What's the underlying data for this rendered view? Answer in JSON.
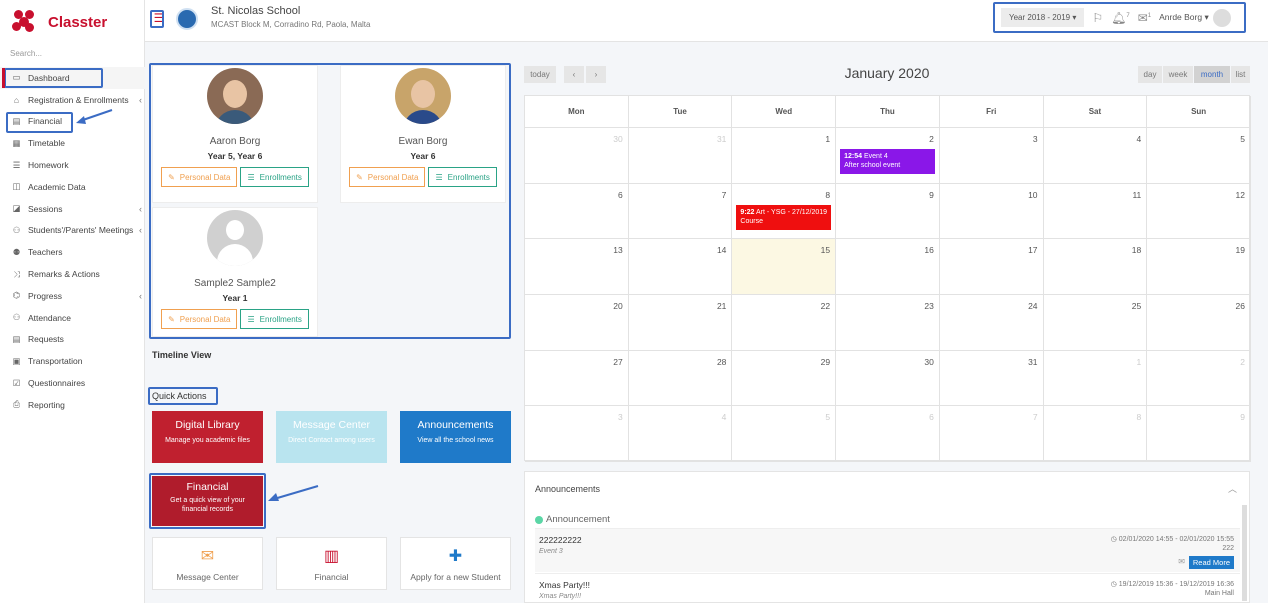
{
  "app": {
    "name": "Classter",
    "search_placeholder": "Search..."
  },
  "sidebar": {
    "items": [
      {
        "label": "Dashboard",
        "icon": "laptop-icon",
        "chevron": false
      },
      {
        "label": "Registration & Enrollments",
        "icon": "bank-icon",
        "chevron": true
      },
      {
        "label": "Financial",
        "icon": "money-icon",
        "chevron": false
      },
      {
        "label": "Timetable",
        "icon": "calendar-icon",
        "chevron": false
      },
      {
        "label": "Homework",
        "icon": "list-icon",
        "chevron": false
      },
      {
        "label": "Academic Data",
        "icon": "chart-icon",
        "chevron": false
      },
      {
        "label": "Sessions",
        "icon": "sessions-icon",
        "chevron": true
      },
      {
        "label": "Students'/Parents' Meetings",
        "icon": "meeting-icon",
        "chevron": true
      },
      {
        "label": "Teachers",
        "icon": "teachers-icon",
        "chevron": false
      },
      {
        "label": "Remarks & Actions",
        "icon": "shuffle-icon",
        "chevron": false
      },
      {
        "label": "Progress",
        "icon": "graduation-icon",
        "chevron": true
      },
      {
        "label": "Attendance",
        "icon": "user-x-icon",
        "chevron": false
      },
      {
        "label": "Requests",
        "icon": "document-icon",
        "chevron": false
      },
      {
        "label": "Transportation",
        "icon": "bus-icon",
        "chevron": false
      },
      {
        "label": "Questionnaires",
        "icon": "checkbox-icon",
        "chevron": false
      },
      {
        "label": "Reporting",
        "icon": "printer-icon",
        "chevron": false
      }
    ]
  },
  "header": {
    "school_name": "St. Nicolas School",
    "school_address": "MCAST Block M, Corradino Rd, Paola, Malta",
    "year": "Year 2018 - 2019",
    "notifications_count": "7",
    "messages_count": "1",
    "user_name": "Anrde Borg"
  },
  "students": [
    {
      "name": "Aaron Borg",
      "year": "Year 5, Year 6",
      "btn_personal": "Personal Data",
      "btn_enroll": "Enrollments"
    },
    {
      "name": "Ewan Borg",
      "year": "Year 6",
      "btn_personal": "Personal Data",
      "btn_enroll": "Enrollments"
    },
    {
      "name": "Sample2 Sample2",
      "year": "Year 1",
      "btn_personal": "Personal Data",
      "btn_enroll": "Enrollments"
    }
  ],
  "timeline_title": "Timeline View",
  "quick_actions": {
    "title": "Quick Actions",
    "tiles": [
      {
        "title": "Digital Library",
        "subtitle": "Manage you academic files",
        "color": "#c0202f"
      },
      {
        "title": "Message Center",
        "subtitle": "Direct Contact among users",
        "color": "#b9e4ef"
      },
      {
        "title": "Announcements",
        "subtitle": "View all the school news",
        "color": "#1f7ac9"
      },
      {
        "title": "Financial",
        "subtitle": "Get a quick view of your financial records",
        "color": "#b01c2c"
      }
    ],
    "shortcuts": [
      {
        "label": "Message Center",
        "icon": "envelope-icon"
      },
      {
        "label": "Financial",
        "icon": "bar-chart-icon"
      },
      {
        "label": "Apply for a new Student",
        "icon": "plus-icon"
      }
    ]
  },
  "calendar": {
    "title": "January 2020",
    "today_label": "today",
    "prev": "‹",
    "next": "›",
    "views": [
      "day",
      "week",
      "month",
      "list"
    ],
    "active_view": "month",
    "dow": [
      "Mon",
      "Tue",
      "Wed",
      "Thu",
      "Fri",
      "Sat",
      "Sun"
    ],
    "weeks": [
      [
        "30",
        "31",
        "1",
        "2",
        "3",
        "4",
        "5"
      ],
      [
        "6",
        "7",
        "8",
        "9",
        "10",
        "11",
        "12"
      ],
      [
        "13",
        "14",
        "15",
        "16",
        "17",
        "18",
        "19"
      ],
      [
        "20",
        "21",
        "22",
        "23",
        "24",
        "25",
        "26"
      ],
      [
        "27",
        "28",
        "29",
        "30",
        "31",
        "1",
        "2"
      ],
      [
        "3",
        "4",
        "5",
        "6",
        "7",
        "8",
        "9"
      ]
    ],
    "events": [
      {
        "week": 0,
        "day": 3,
        "time": "12:54",
        "title": "Event 4",
        "desc": "After school event",
        "color": "#8a17e8"
      },
      {
        "week": 1,
        "day": 2,
        "time": "9:22",
        "title": "Art - YSG - 27/12/2019",
        "desc": "Course",
        "color": "#ef0f0f"
      }
    ]
  },
  "announcements": {
    "title": "Announcements",
    "subtitle": "Announcement",
    "items": [
      {
        "title": "222222222",
        "desc": "Event 3",
        "date": "02/01/2020 14:55 - 02/01/2020 15:55",
        "extra": "222",
        "button": "Read More"
      },
      {
        "title": "Xmas Party!!!",
        "desc": "Xmas Party!!!",
        "date": "19/12/2019 15:36 - 19/12/2019 16:36",
        "extra": "Main Hall"
      }
    ]
  }
}
